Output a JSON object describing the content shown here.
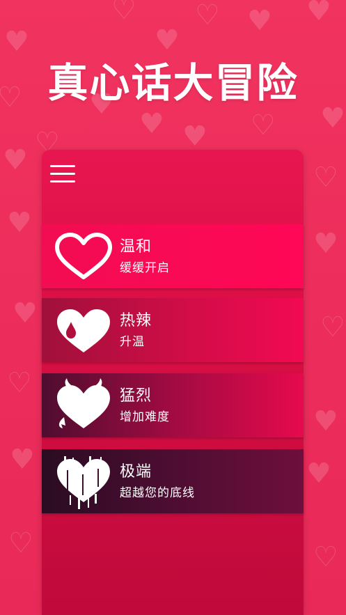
{
  "app": {
    "title": "真心话大冒险"
  },
  "menu_icon": "hamburger-menu-icon",
  "levels": [
    {
      "label": "温和",
      "description": "缓缓开启",
      "icon": "outline-heart-icon"
    },
    {
      "label": "热辣",
      "description": "升温",
      "icon": "heart-drop-icon"
    },
    {
      "label": "猛烈",
      "description": "增加难度",
      "icon": "devil-heart-icon"
    },
    {
      "label": "极端",
      "description": "超越您的底线",
      "icon": "glitch-heart-icon"
    }
  ],
  "colors": {
    "background": "#ee2f5e",
    "card": "#d80e44",
    "text": "#ffffff"
  }
}
